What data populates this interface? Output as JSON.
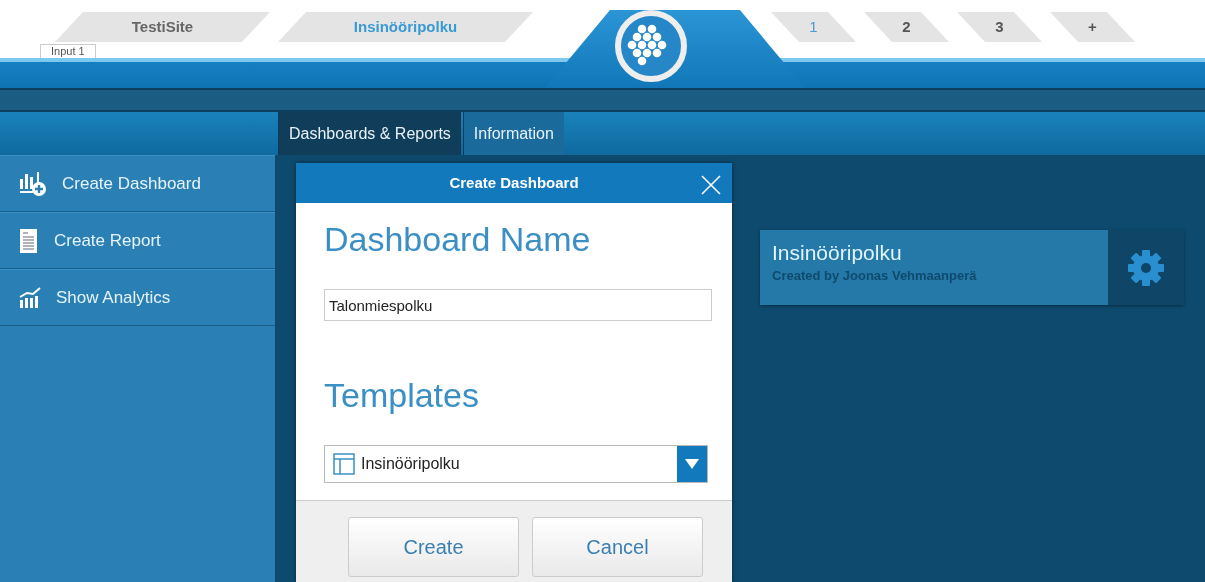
{
  "top_tabs": [
    {
      "label": "TestiSite",
      "selected": false
    },
    {
      "label": "Insinööripolku",
      "selected": true
    }
  ],
  "input_label": "Input 1",
  "page_tabs": [
    {
      "label": "1",
      "selected": true
    },
    {
      "label": "2",
      "selected": false
    },
    {
      "label": "3",
      "selected": false
    },
    {
      "label": "+",
      "selected": false
    }
  ],
  "nav_tabs": [
    {
      "label": "Dashboards & Reports",
      "selected": true
    },
    {
      "label": "Information",
      "selected": false
    }
  ],
  "sidebar": {
    "items": [
      {
        "label": "Create Dashboard",
        "kind": "dashboard"
      },
      {
        "label": "Create Report",
        "kind": "report"
      },
      {
        "label": "Show Analytics",
        "kind": "analytics"
      }
    ]
  },
  "dialog": {
    "title": "Create Dashboard",
    "name_heading": "Dashboard Name",
    "name_value": "Talonmiespolku",
    "templates_heading": "Templates",
    "template_value": "Insinööripolku",
    "buttons": [
      "Create",
      "Cancel"
    ]
  },
  "dashboards": [
    {
      "title": "Insinööripolku",
      "subtitle": "Created by Joonas Vehmaanperä"
    }
  ]
}
